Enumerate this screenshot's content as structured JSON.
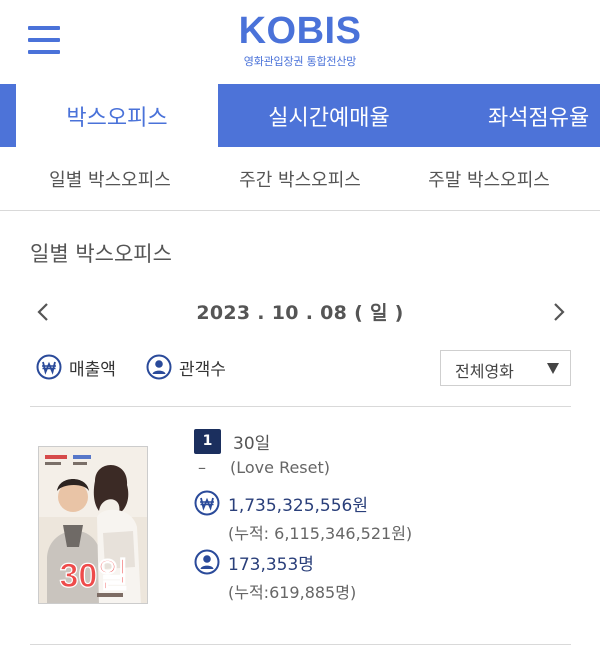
{
  "header": {
    "logo": "KOBIS",
    "logo_subtitle": "영화관입장권 통합전산망",
    "menu_icon": "hamburger-menu-icon"
  },
  "main_tabs": [
    {
      "label": "박스오피스",
      "active": true
    },
    {
      "label": "실시간예매율",
      "active": false
    },
    {
      "label": "좌석점유율",
      "active": false
    }
  ],
  "sub_tabs": [
    {
      "label": "일별 박스오피스"
    },
    {
      "label": "주간 박스오피스"
    },
    {
      "label": "주말 박스오피스"
    }
  ],
  "section": {
    "title": "일별 박스오피스",
    "date": "2023 . 10 . 08 ( 일 )",
    "prev_icon": "chevron-left-icon",
    "next_icon": "chevron-right-icon"
  },
  "toggles": {
    "sales_label": "매출액",
    "audience_label": "관객수",
    "sales_icon": "won-icon",
    "audience_icon": "person-icon"
  },
  "filter": {
    "selected": "전체영화"
  },
  "movies": [
    {
      "rank": "1",
      "title": "30일",
      "rank_change": "–",
      "english_title": "(Love Reset)",
      "sales": "1,735,325,556원",
      "sales_cumulative": "(누적: 6,115,346,521원)",
      "audience": "173,353명",
      "audience_cumulative": "(누적:619,885명)",
      "poster_text": "30일"
    }
  ],
  "colors": {
    "brand": "#4a72d9",
    "tab_bar": "#4d73d8",
    "rank_badge": "#1b2f5e",
    "stat_value": "#2a3f7a"
  }
}
